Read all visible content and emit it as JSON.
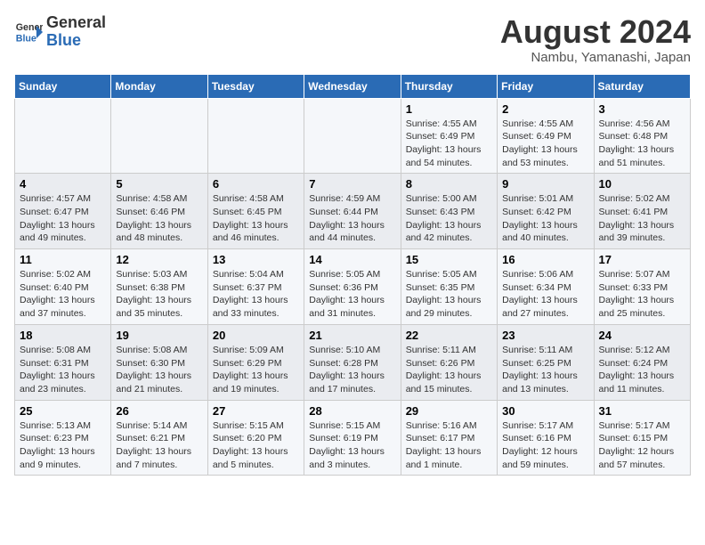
{
  "header": {
    "logo_line1": "General",
    "logo_line2": "Blue",
    "main_title": "August 2024",
    "subtitle": "Nambu, Yamanashi, Japan"
  },
  "weekdays": [
    "Sunday",
    "Monday",
    "Tuesday",
    "Wednesday",
    "Thursday",
    "Friday",
    "Saturday"
  ],
  "weeks": [
    [
      {
        "day": "",
        "info": ""
      },
      {
        "day": "",
        "info": ""
      },
      {
        "day": "",
        "info": ""
      },
      {
        "day": "",
        "info": ""
      },
      {
        "day": "1",
        "info": "Sunrise: 4:55 AM\nSunset: 6:49 PM\nDaylight: 13 hours\nand 54 minutes."
      },
      {
        "day": "2",
        "info": "Sunrise: 4:55 AM\nSunset: 6:49 PM\nDaylight: 13 hours\nand 53 minutes."
      },
      {
        "day": "3",
        "info": "Sunrise: 4:56 AM\nSunset: 6:48 PM\nDaylight: 13 hours\nand 51 minutes."
      }
    ],
    [
      {
        "day": "4",
        "info": "Sunrise: 4:57 AM\nSunset: 6:47 PM\nDaylight: 13 hours\nand 49 minutes."
      },
      {
        "day": "5",
        "info": "Sunrise: 4:58 AM\nSunset: 6:46 PM\nDaylight: 13 hours\nand 48 minutes."
      },
      {
        "day": "6",
        "info": "Sunrise: 4:58 AM\nSunset: 6:45 PM\nDaylight: 13 hours\nand 46 minutes."
      },
      {
        "day": "7",
        "info": "Sunrise: 4:59 AM\nSunset: 6:44 PM\nDaylight: 13 hours\nand 44 minutes."
      },
      {
        "day": "8",
        "info": "Sunrise: 5:00 AM\nSunset: 6:43 PM\nDaylight: 13 hours\nand 42 minutes."
      },
      {
        "day": "9",
        "info": "Sunrise: 5:01 AM\nSunset: 6:42 PM\nDaylight: 13 hours\nand 40 minutes."
      },
      {
        "day": "10",
        "info": "Sunrise: 5:02 AM\nSunset: 6:41 PM\nDaylight: 13 hours\nand 39 minutes."
      }
    ],
    [
      {
        "day": "11",
        "info": "Sunrise: 5:02 AM\nSunset: 6:40 PM\nDaylight: 13 hours\nand 37 minutes."
      },
      {
        "day": "12",
        "info": "Sunrise: 5:03 AM\nSunset: 6:38 PM\nDaylight: 13 hours\nand 35 minutes."
      },
      {
        "day": "13",
        "info": "Sunrise: 5:04 AM\nSunset: 6:37 PM\nDaylight: 13 hours\nand 33 minutes."
      },
      {
        "day": "14",
        "info": "Sunrise: 5:05 AM\nSunset: 6:36 PM\nDaylight: 13 hours\nand 31 minutes."
      },
      {
        "day": "15",
        "info": "Sunrise: 5:05 AM\nSunset: 6:35 PM\nDaylight: 13 hours\nand 29 minutes."
      },
      {
        "day": "16",
        "info": "Sunrise: 5:06 AM\nSunset: 6:34 PM\nDaylight: 13 hours\nand 27 minutes."
      },
      {
        "day": "17",
        "info": "Sunrise: 5:07 AM\nSunset: 6:33 PM\nDaylight: 13 hours\nand 25 minutes."
      }
    ],
    [
      {
        "day": "18",
        "info": "Sunrise: 5:08 AM\nSunset: 6:31 PM\nDaylight: 13 hours\nand 23 minutes."
      },
      {
        "day": "19",
        "info": "Sunrise: 5:08 AM\nSunset: 6:30 PM\nDaylight: 13 hours\nand 21 minutes."
      },
      {
        "day": "20",
        "info": "Sunrise: 5:09 AM\nSunset: 6:29 PM\nDaylight: 13 hours\nand 19 minutes."
      },
      {
        "day": "21",
        "info": "Sunrise: 5:10 AM\nSunset: 6:28 PM\nDaylight: 13 hours\nand 17 minutes."
      },
      {
        "day": "22",
        "info": "Sunrise: 5:11 AM\nSunset: 6:26 PM\nDaylight: 13 hours\nand 15 minutes."
      },
      {
        "day": "23",
        "info": "Sunrise: 5:11 AM\nSunset: 6:25 PM\nDaylight: 13 hours\nand 13 minutes."
      },
      {
        "day": "24",
        "info": "Sunrise: 5:12 AM\nSunset: 6:24 PM\nDaylight: 13 hours\nand 11 minutes."
      }
    ],
    [
      {
        "day": "25",
        "info": "Sunrise: 5:13 AM\nSunset: 6:23 PM\nDaylight: 13 hours\nand 9 minutes."
      },
      {
        "day": "26",
        "info": "Sunrise: 5:14 AM\nSunset: 6:21 PM\nDaylight: 13 hours\nand 7 minutes."
      },
      {
        "day": "27",
        "info": "Sunrise: 5:15 AM\nSunset: 6:20 PM\nDaylight: 13 hours\nand 5 minutes."
      },
      {
        "day": "28",
        "info": "Sunrise: 5:15 AM\nSunset: 6:19 PM\nDaylight: 13 hours\nand 3 minutes."
      },
      {
        "day": "29",
        "info": "Sunrise: 5:16 AM\nSunset: 6:17 PM\nDaylight: 13 hours\nand 1 minute."
      },
      {
        "day": "30",
        "info": "Sunrise: 5:17 AM\nSunset: 6:16 PM\nDaylight: 12 hours\nand 59 minutes."
      },
      {
        "day": "31",
        "info": "Sunrise: 5:17 AM\nSunset: 6:15 PM\nDaylight: 12 hours\nand 57 minutes."
      }
    ]
  ]
}
